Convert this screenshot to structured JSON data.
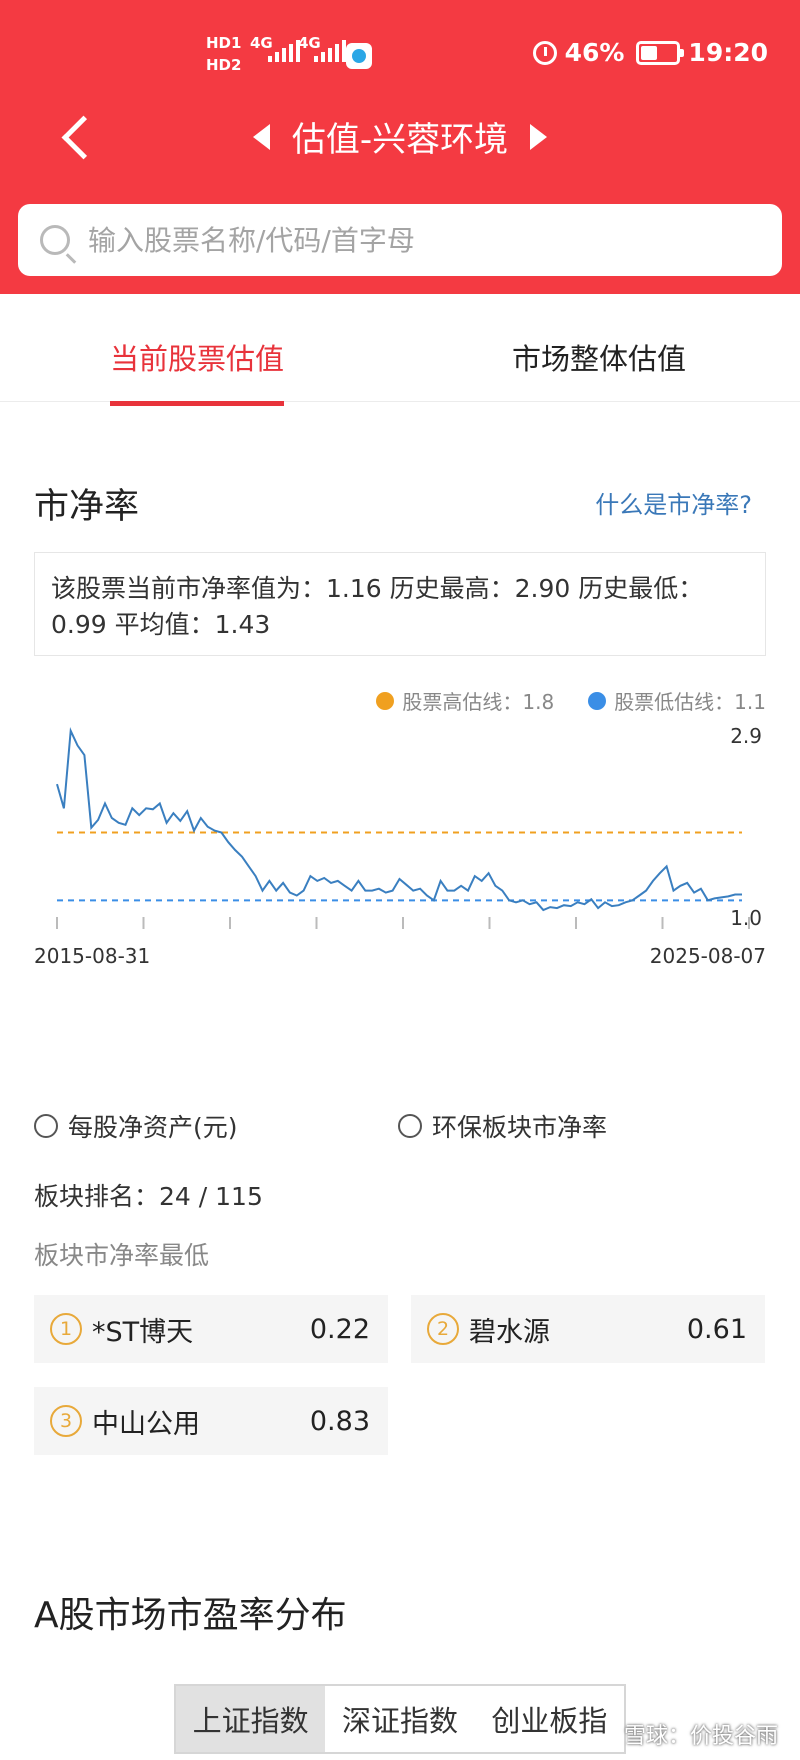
{
  "status": {
    "hd1": "HD1",
    "hd2": "HD2",
    "net1": "4G",
    "net2": "4G",
    "battery": "46%",
    "time": "19:20"
  },
  "nav": {
    "title": "估值-兴蓉环境"
  },
  "search": {
    "placeholder": "输入股票名称/代码/首字母"
  },
  "tabs": {
    "current": "当前股票估值",
    "market": "市场整体估值"
  },
  "pb": {
    "title": "市净率",
    "help_link": "什么是市净率?",
    "summary": "该股票当前市净率值为：1.16 历史最高：2.90 历史最低：0.99 平均值：1.43"
  },
  "legend": {
    "high": "股票高估线：1.8",
    "low": "股票低估线：1.1",
    "high_color": "#f0a020",
    "low_color": "#3a8ee6"
  },
  "chart_data": {
    "type": "line",
    "title": "",
    "x_start": "2015-08-31",
    "x_end": "2025-08-07",
    "ylim": [
      1.0,
      2.9
    ],
    "y_top_label": "2.9",
    "y_bottom_label": "1.0",
    "high_line": 1.8,
    "low_line": 1.1,
    "line_color": "#3a7fc0",
    "x": [
      0,
      0.01,
      0.02,
      0.03,
      0.04,
      0.05,
      0.06,
      0.07,
      0.08,
      0.09,
      0.1,
      0.11,
      0.12,
      0.13,
      0.14,
      0.15,
      0.16,
      0.17,
      0.18,
      0.19,
      0.2,
      0.21,
      0.22,
      0.23,
      0.24,
      0.25,
      0.26,
      0.27,
      0.28,
      0.29,
      0.3,
      0.31,
      0.32,
      0.33,
      0.34,
      0.35,
      0.36,
      0.37,
      0.38,
      0.39,
      0.4,
      0.41,
      0.42,
      0.43,
      0.44,
      0.45,
      0.46,
      0.47,
      0.48,
      0.49,
      0.5,
      0.51,
      0.52,
      0.53,
      0.54,
      0.55,
      0.56,
      0.57,
      0.58,
      0.59,
      0.6,
      0.61,
      0.62,
      0.63,
      0.64,
      0.65,
      0.66,
      0.67,
      0.68,
      0.69,
      0.7,
      0.71,
      0.72,
      0.73,
      0.74,
      0.75,
      0.76,
      0.77,
      0.78,
      0.79,
      0.8,
      0.81,
      0.82,
      0.83,
      0.84,
      0.85,
      0.86,
      0.87,
      0.88,
      0.89,
      0.9,
      0.91,
      0.92,
      0.93,
      0.94,
      0.95,
      0.96,
      0.97,
      0.98,
      0.99,
      1
    ],
    "values": [
      2.3,
      2.05,
      2.85,
      2.7,
      2.6,
      1.85,
      1.93,
      2.1,
      1.95,
      1.9,
      1.88,
      2.05,
      1.98,
      2.05,
      2.04,
      2.1,
      1.9,
      2.0,
      1.92,
      2.02,
      1.82,
      1.95,
      1.86,
      1.82,
      1.8,
      1.7,
      1.62,
      1.55,
      1.45,
      1.35,
      1.2,
      1.3,
      1.2,
      1.28,
      1.18,
      1.15,
      1.2,
      1.35,
      1.3,
      1.33,
      1.28,
      1.3,
      1.25,
      1.2,
      1.3,
      1.2,
      1.2,
      1.22,
      1.18,
      1.2,
      1.32,
      1.26,
      1.2,
      1.22,
      1.15,
      1.1,
      1.3,
      1.2,
      1.2,
      1.25,
      1.2,
      1.35,
      1.3,
      1.38,
      1.25,
      1.2,
      1.1,
      1.08,
      1.1,
      1.06,
      1.08,
      1.0,
      1.03,
      1.02,
      1.05,
      1.04,
      1.08,
      1.06,
      1.11,
      1.02,
      1.08,
      1.04,
      1.05,
      1.08,
      1.1,
      1.15,
      1.2,
      1.3,
      1.38,
      1.45,
      1.2,
      1.25,
      1.28,
      1.18,
      1.22,
      1.1,
      1.12,
      1.13,
      1.14,
      1.16,
      1.16
    ]
  },
  "options": {
    "bvps": "每股净资产(元)",
    "sector_pb": "环保板块市净率"
  },
  "rank": {
    "text": "板块排名：24 / 115"
  },
  "lowest": {
    "label": "板块市净率最低",
    "items": [
      {
        "num": "1",
        "name": "*ST博天",
        "value": "0.22"
      },
      {
        "num": "2",
        "name": "碧水源",
        "value": "0.61"
      },
      {
        "num": "3",
        "name": "中山公用",
        "value": "0.83"
      }
    ]
  },
  "pe": {
    "title": "A股市场市盈率分布",
    "tabs": [
      "上证指数",
      "深证指数",
      "创业板指"
    ]
  },
  "watermark": "雪球：价投谷雨"
}
